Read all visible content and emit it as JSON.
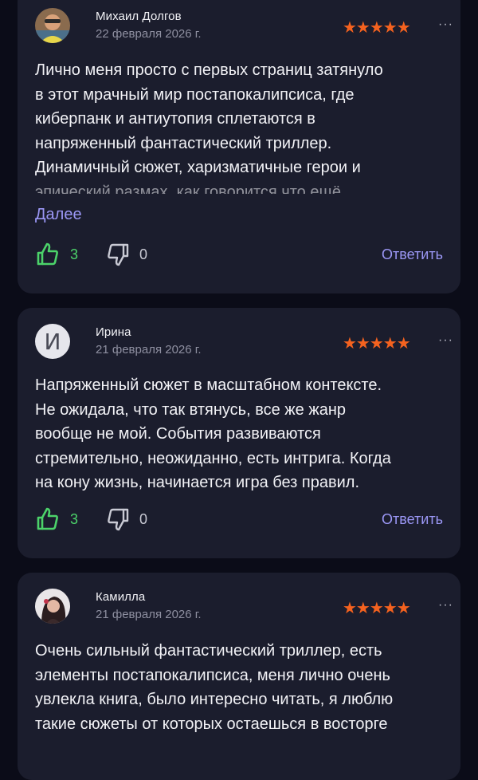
{
  "colors": {
    "background": "#0b0c18",
    "card": "#1b1d2d",
    "star": "#f4621f",
    "like": "#4cd36a",
    "link": "#9b97f5"
  },
  "reviews": [
    {
      "author": "Михаил Долгов",
      "date": "22 февраля 2026 г.",
      "stars": "★★★★★",
      "rating": 5,
      "more": "···",
      "lines": [
        "Лично меня просто с первых страниц затянуло",
        "в этот мрачный мир постапокалипсиса, где",
        "киберпанк и антиутопия сплетаются в",
        "напряженный фантастический триллер.",
        "Динамичный сюжет, харизматичные герои и",
        "эпический размах, как говорится что ещё"
      ],
      "more_link": "Далее",
      "likes": "3",
      "dislikes": "0",
      "reply": "Ответить"
    },
    {
      "author": "Ирина",
      "avatar_letter": "И",
      "date": "21 февраля 2026 г.",
      "stars": "★★★★★",
      "rating": 5,
      "more": "···",
      "lines": [
        "Напряженный сюжет в масштабном контексте.",
        "Не ожидала, что так втянусь, все же жанр",
        "вообще не мой. События развиваются",
        "стремительно, неожиданно, есть интрига. Когда",
        "на кону жизнь, начинается игра без правил."
      ],
      "likes": "3",
      "dislikes": "0",
      "reply": "Ответить"
    },
    {
      "author": "Камилла",
      "date": "21 февраля 2026 г.",
      "stars": "★★★★★",
      "rating": 5,
      "more": "···",
      "lines": [
        "Очень сильный фантастический триллер, есть",
        "элементы постапокалипсиса, меня лично очень",
        "увлекла книга, было интересно читать, я люблю",
        "такие сюжеты от которых остаешься в восторге"
      ]
    }
  ]
}
